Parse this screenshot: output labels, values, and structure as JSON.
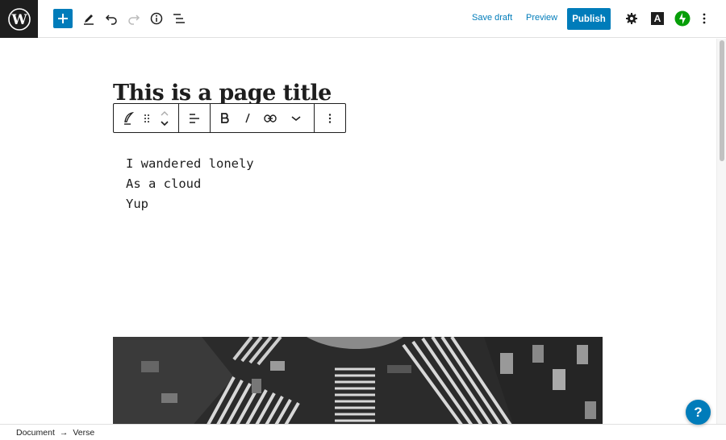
{
  "header": {
    "logo_icon": "wordpress-logo-icon",
    "save_draft_label": "Save draft",
    "preview_label": "Preview",
    "publish_label": "Publish",
    "plugin_badge": "A"
  },
  "editor": {
    "page_title": "This is a page title",
    "verse_lines": [
      "I wandered lonely",
      "As a cloud",
      "Yup"
    ]
  },
  "footer": {
    "breadcrumb": [
      "Document",
      "Verse"
    ],
    "separator": "→"
  },
  "help": {
    "label": "?"
  },
  "colors": {
    "accent": "#007cba",
    "logo_bg": "#1e1e1e",
    "jetpack_green": "#069e08"
  }
}
